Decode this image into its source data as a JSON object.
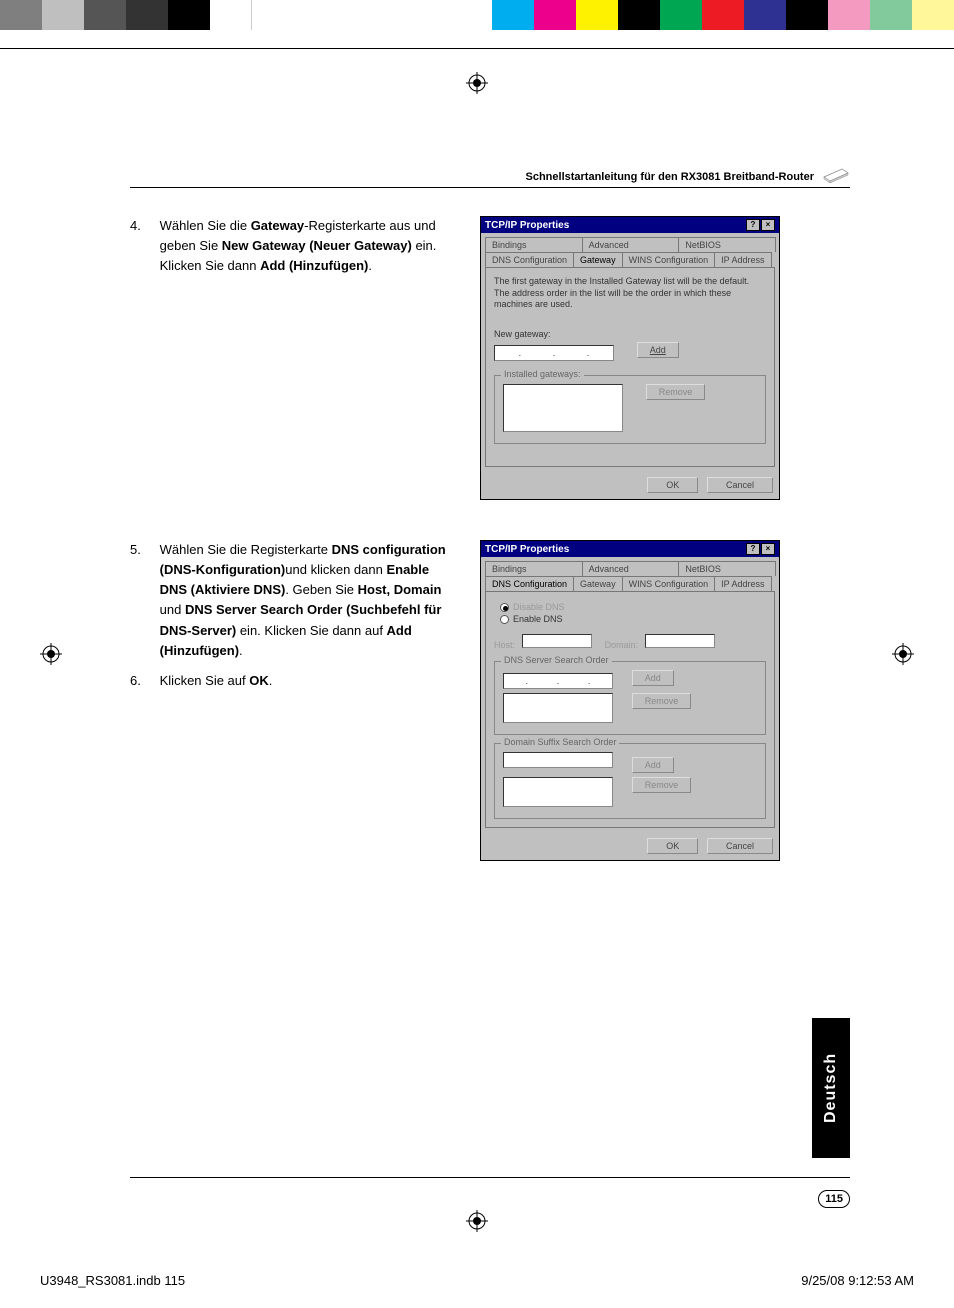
{
  "header": {
    "title": "Schnellstartanleitung für den RX3081 Breitband-Router"
  },
  "steps": {
    "s4": {
      "num": "4.",
      "p1a": "Wählen Sie die ",
      "b1": "Gateway",
      "p1b": "-Registerkarte aus und geben Sie ",
      "b2": "New Gateway (Neuer Gateway)",
      "p1c": " ein. Klicken Sie dann ",
      "b3": "Add (Hinzufügen)",
      "p1d": "."
    },
    "s5": {
      "num": "5.",
      "p1a": "Wählen Sie die Registerkarte ",
      "b1": "DNS configuration (DNS-Konfiguration)",
      "p1b": "und klicken dann ",
      "b2": "Enable DNS (Aktiviere DNS)",
      "p1c": ". Geben Sie ",
      "b3": "Host, Domain",
      "p1d": " und ",
      "b4": "DNS Server Search Order (Suchbefehl für DNS-Server)",
      "p1e": " ein. Klicken Sie dann auf ",
      "b5": "Add (Hinzufügen)",
      "p1f": "."
    },
    "s6": {
      "num": "6.",
      "p1a": "Klicken Sie auf ",
      "b1": "OK",
      "p1b": "."
    }
  },
  "dialog1": {
    "title": "TCP/IP Properties",
    "help": "?",
    "close": "×",
    "tabs_top": [
      "Bindings",
      "Advanced",
      "NetBIOS"
    ],
    "tabs_bottom": [
      "DNS Configuration",
      "Gateway",
      "WINS Configuration",
      "IP Address"
    ],
    "active_tab": "Gateway",
    "info": "The first gateway in the Installed Gateway list will be the default. The address order in the list will be the order in which these machines are used.",
    "new_gateway_label": "New gateway:",
    "add": "Add",
    "installed_label": "Installed gateways:",
    "remove": "Remove",
    "ok": "OK",
    "cancel": "Cancel"
  },
  "dialog2": {
    "title": "TCP/IP Properties",
    "help": "?",
    "close": "×",
    "tabs_top": [
      "Bindings",
      "Advanced",
      "NetBIOS"
    ],
    "tabs_bottom": [
      "DNS Configuration",
      "Gateway",
      "WINS Configuration",
      "IP Address"
    ],
    "active_tab": "DNS Configuration",
    "radio_disable": "Disable DNS",
    "radio_enable": "Enable DNS",
    "host_label": "Host:",
    "domain_label": "Domain:",
    "dns_order_label": "DNS Server Search Order",
    "add": "Add",
    "remove": "Remove",
    "suffix_label": "Domain Suffix Search Order",
    "ok": "OK",
    "cancel": "Cancel"
  },
  "langtab": "Deutsch",
  "pagenum": "115",
  "footer": {
    "left": "U3948_RS3081.indb   115",
    "right": "9/25/08   9:12:53 AM"
  },
  "colorbars": {
    "left": [
      "#7f7f7f",
      "#bfbfbf",
      "#555555",
      "#333333",
      "#000000",
      "#ffffff"
    ],
    "right": [
      "#00aeef",
      "#ec008c",
      "#fff200",
      "#000000",
      "#00a651",
      "#ed1c24",
      "#2e3192",
      "#000000",
      "#f49ac1",
      "#82ca9c",
      "#fff799"
    ]
  }
}
